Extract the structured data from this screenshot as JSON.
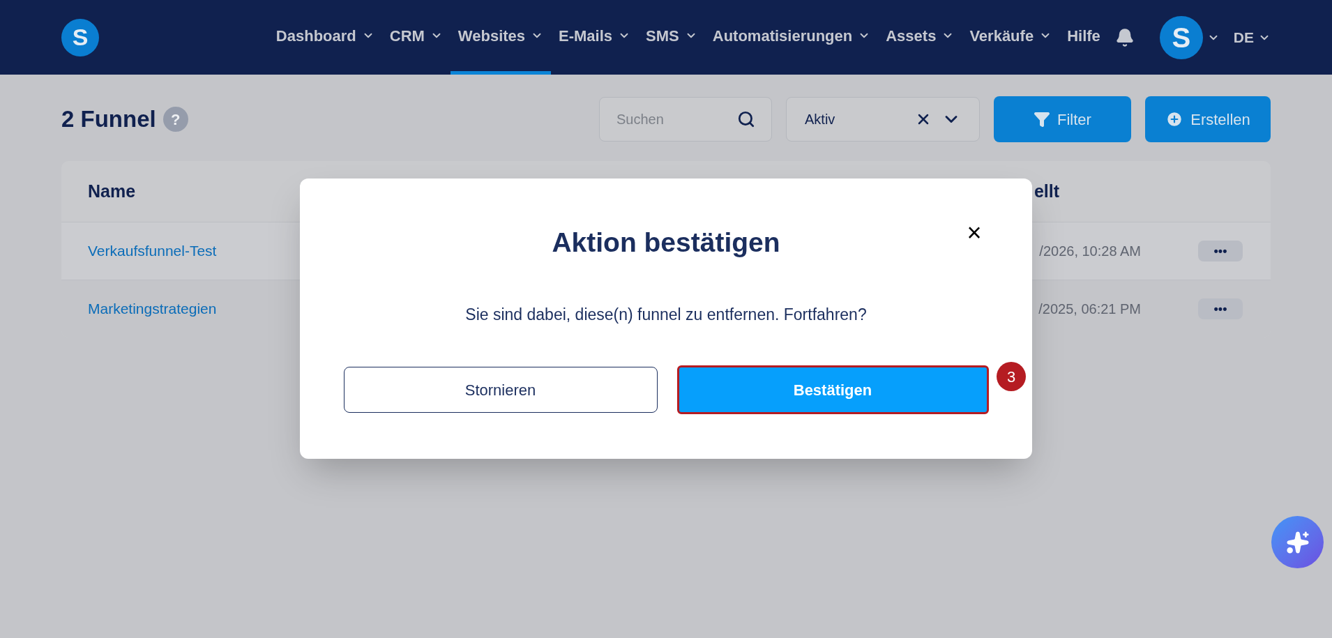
{
  "nav": {
    "logo": "S",
    "items": [
      {
        "label": "Dashboard",
        "has_menu": true,
        "selected": false
      },
      {
        "label": "CRM",
        "has_menu": true,
        "selected": false
      },
      {
        "label": "Websites",
        "has_menu": true,
        "selected": true
      },
      {
        "label": "E-Mails",
        "has_menu": true,
        "selected": false
      },
      {
        "label": "SMS",
        "has_menu": true,
        "selected": false
      },
      {
        "label": "Automatisierungen",
        "has_menu": true,
        "selected": false
      },
      {
        "label": "Assets",
        "has_menu": true,
        "selected": false
      },
      {
        "label": "Verkäufe",
        "has_menu": true,
        "selected": false
      },
      {
        "label": "Hilfe",
        "has_menu": false,
        "selected": false
      }
    ],
    "avatar": "S",
    "language": "DE"
  },
  "page": {
    "title": "2 Funnel",
    "help": "?"
  },
  "toolbar": {
    "search": {
      "placeholder": "Suchen"
    },
    "status_select": {
      "value": "Aktiv"
    },
    "filter_button": "Filter",
    "create_button": "Erstellen"
  },
  "table": {
    "columns": [
      "Name",
      "ellt"
    ],
    "rows": [
      {
        "name": "Verkaufsfunnel-Test",
        "date": "/2026, 10:28 AM",
        "menu": "•••"
      },
      {
        "name": "Marketingstrategien",
        "date": "/2025, 06:21 PM",
        "menu": "•••"
      }
    ]
  },
  "dialog": {
    "title": "Aktion bestätigen",
    "close": "×",
    "message": "Sie sind dabei, diese(n) funnel zu entfernen. Fortfahren?",
    "cancel": "Stornieren",
    "confirm": "Bestätigen",
    "step_badge": "3"
  }
}
